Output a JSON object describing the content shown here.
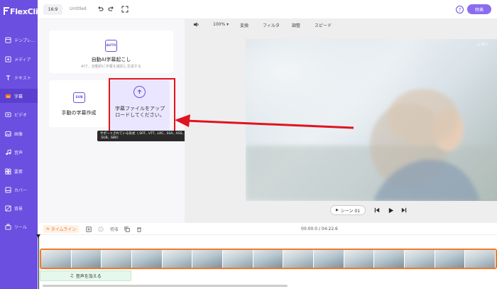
{
  "app": {
    "logo": "FlexClip"
  },
  "sidebar": {
    "items": [
      {
        "label": "テンプレ…",
        "icon": "template-icon"
      },
      {
        "label": "メディア",
        "icon": "media-icon"
      },
      {
        "label": "テキスト",
        "icon": "text-icon"
      },
      {
        "label": "字幕",
        "icon": "subtitle-icon"
      },
      {
        "label": "ビデオ",
        "icon": "video-icon"
      },
      {
        "label": "画像",
        "icon": "image-icon"
      },
      {
        "label": "音声",
        "icon": "audio-icon"
      },
      {
        "label": "要素",
        "icon": "elements-icon"
      },
      {
        "label": "カバー",
        "icon": "cover-icon"
      },
      {
        "label": "背景",
        "icon": "background-icon"
      },
      {
        "label": "ツール",
        "icon": "tools-icon"
      }
    ],
    "active_index": 3
  },
  "topbar": {
    "ratio": "16:9",
    "project_name": "Untitled",
    "premium_label": "特典"
  },
  "panel": {
    "auto_card": {
      "icon_text": "AUTO",
      "title": "自動AI字幕起こし",
      "subtitle": "AIで、自動的に字幕を識別し生成する"
    },
    "manual_card": {
      "icon_text": "SUB",
      "title": "手動の字幕作成"
    },
    "upload_card": {
      "title": "字幕ファイルをアップロードしてください。"
    },
    "tooltip": "サポートされている形式（.SRT, .VTT, .LRC, .SSA, .ASS, .SUB, .SBV）"
  },
  "preview_toolbar": {
    "zoom": "100%",
    "items": [
      "変換",
      "フィルタ",
      "調整",
      "スピード"
    ]
  },
  "preview": {
    "watermark": "◎ 電子 ...",
    "scene_label": "シーン 01"
  },
  "timeline": {
    "tab_label": "タイムライン",
    "cut_label": "切る",
    "time": "00:00.0 / 04:22.6",
    "add_audio_label": "音声を加える"
  },
  "colors": {
    "brand": "#6a4fe0",
    "accent": "#f07a2a",
    "highlight": "#e0141e"
  }
}
